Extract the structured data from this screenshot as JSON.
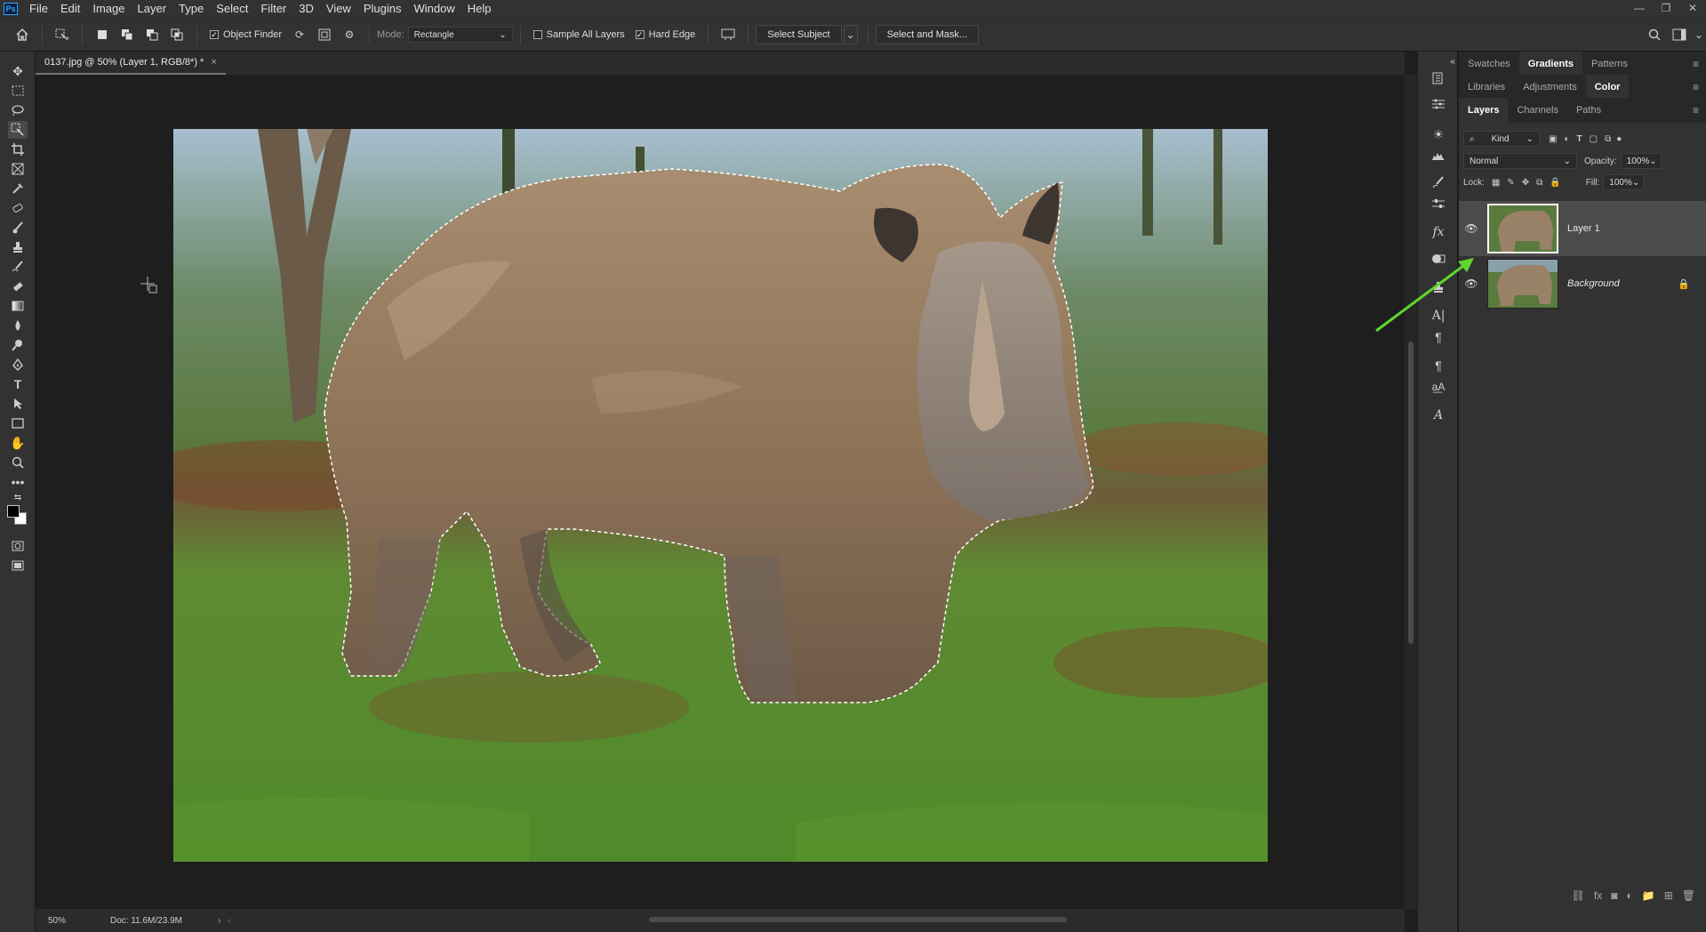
{
  "app": {
    "logo": "Ps"
  },
  "menu": [
    "File",
    "Edit",
    "Image",
    "Layer",
    "Type",
    "Select",
    "Filter",
    "3D",
    "View",
    "Plugins",
    "Window",
    "Help"
  ],
  "window_controls": [
    "—",
    "❐",
    "✕"
  ],
  "options": {
    "object_finder": "Object Finder",
    "mode_label": "Mode:",
    "mode_value": "Rectangle",
    "sample_all_layers": "Sample All Layers",
    "hard_edge": "Hard Edge",
    "select_subject": "Select Subject",
    "select_and_mask": "Select and Mask..."
  },
  "document": {
    "tab_title": "0137.jpg @ 50% (Layer 1, RGB/8*) *",
    "close": "×"
  },
  "status": {
    "zoom": "50%",
    "doc_size": "Doc: 11.6M/23.9M"
  },
  "panels": {
    "top_tabs": [
      "Swatches",
      "Gradients",
      "Patterns"
    ],
    "top_active": "Gradients",
    "mid_tabs": [
      "Libraries",
      "Adjustments",
      "Color"
    ],
    "mid_active": "Color",
    "layer_tabs": [
      "Layers",
      "Channels",
      "Paths"
    ],
    "layer_active": "Layers"
  },
  "layers_panel": {
    "filter_kind": "Kind",
    "blend_mode": "Normal",
    "opacity_label": "Opacity:",
    "opacity_value": "100%",
    "lock_label": "Lock:",
    "fill_label": "Fill:",
    "fill_value": "100%",
    "layers": [
      {
        "name": "Layer 1",
        "selected": true,
        "visible": true
      },
      {
        "name": "Background",
        "selected": false,
        "visible": true,
        "locked": true
      }
    ]
  },
  "colors": {
    "accent_arrow": "#5fd62e",
    "selected_layer": "#4b4b4b"
  }
}
